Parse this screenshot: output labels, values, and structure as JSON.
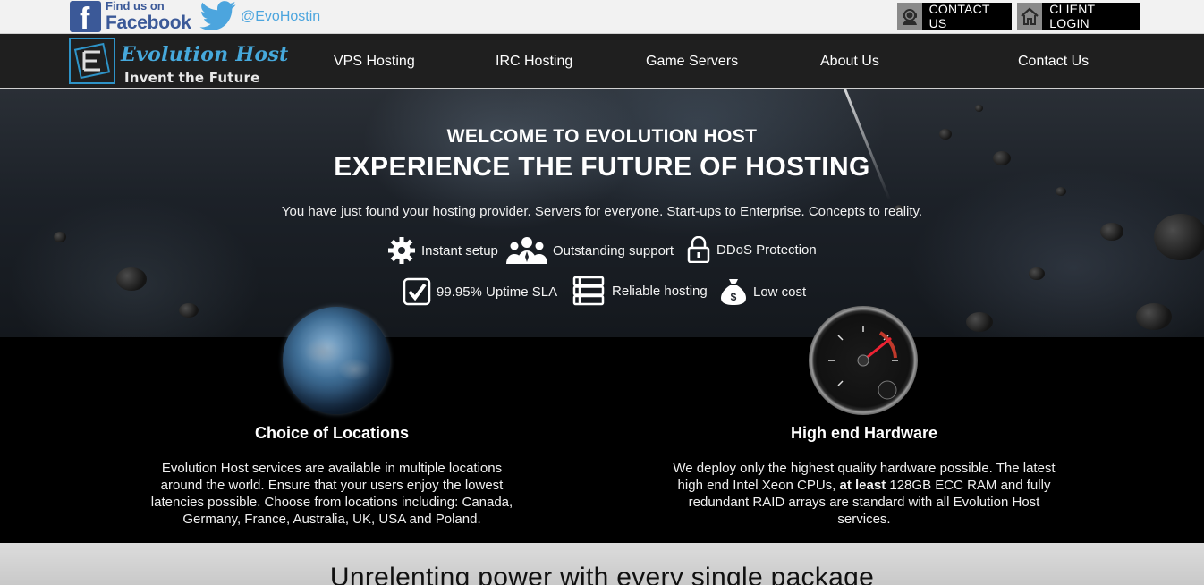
{
  "topbar": {
    "facebook": {
      "line1": "Find us on",
      "line2": "Facebook",
      "icon": "facebook-icon",
      "color": "#3b5998"
    },
    "twitter": {
      "handle": "@EvoHostin",
      "icon": "twitter-icon",
      "color": "#4ca5de"
    },
    "contact_button": {
      "label": "CONTACT US",
      "icon": "support-agent-icon"
    },
    "login_button": {
      "label": "CLIENT LOGIN",
      "icon": "home-icon"
    }
  },
  "header": {
    "logo": {
      "brand": "Evolution Host",
      "tagline": "Invent the Future"
    },
    "nav": [
      {
        "label": "VPS Hosting"
      },
      {
        "label": "IRC Hosting"
      },
      {
        "label": "Game Servers"
      },
      {
        "label": "About Us"
      },
      {
        "label": "Contact Us"
      }
    ]
  },
  "hero": {
    "kicker": "WELCOME TO EVOLUTION HOST",
    "title": "EXPERIENCE THE FUTURE OF HOSTING",
    "subtitle": "You have just found your hosting provider. Servers for everyone. Start-ups to Enterprise. Concepts to reality.",
    "features": [
      {
        "label": "Instant setup",
        "icon": "gear-icon"
      },
      {
        "label": "Outstanding support",
        "icon": "team-icon"
      },
      {
        "label": "DDoS Protection",
        "icon": "lock-icon"
      },
      {
        "label": "99.95% Uptime SLA",
        "icon": "checkbox-icon"
      },
      {
        "label": "Reliable hosting",
        "icon": "server-icon"
      },
      {
        "label": "Low cost",
        "icon": "money-bag-icon"
      }
    ]
  },
  "features": {
    "locations": {
      "title": "Choice of Locations",
      "text": "Evolution Host services are available in multiple locations around the world. Ensure that your users enjoy the lowest latencies possible. Choose from locations including: Canada, Germany, France, Australia, UK, USA and Poland.",
      "image": "globe-image"
    },
    "hardware": {
      "title": "High end Hardware",
      "text_before": "We deploy only the highest quality hardware possible. The latest high end Intel Xeon CPUs, ",
      "text_bold": "at least",
      "text_after": " 128GB ECC RAM and fully redundant RAID arrays are standard with all Evolution Host services.",
      "image": "speedometer-image"
    }
  },
  "bottom": {
    "heading": "Unrelenting power with every single package"
  }
}
